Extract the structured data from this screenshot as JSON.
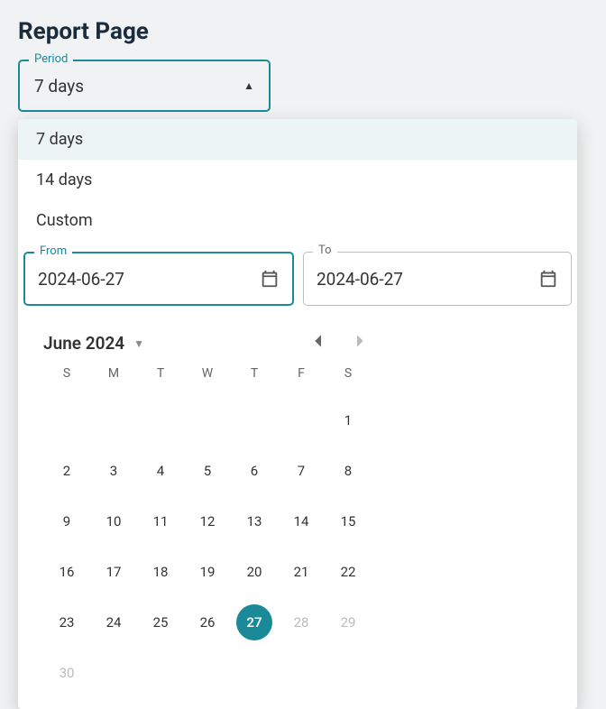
{
  "title": "Report Page",
  "period": {
    "label": "Period",
    "value": "7 days",
    "options": [
      "7 days",
      "14 days",
      "Custom"
    ],
    "selectedIndex": 0
  },
  "from": {
    "label": "From",
    "value": "2024-06-27"
  },
  "to": {
    "label": "To",
    "value": "2024-06-27"
  },
  "calendar": {
    "monthLabel": "June 2024",
    "dow": [
      "S",
      "M",
      "T",
      "W",
      "T",
      "F",
      "S"
    ],
    "leadingBlanks": 6,
    "daysInMonth": 30,
    "today": 27,
    "disabledAfter": 27,
    "accent": "#1a8a99"
  }
}
